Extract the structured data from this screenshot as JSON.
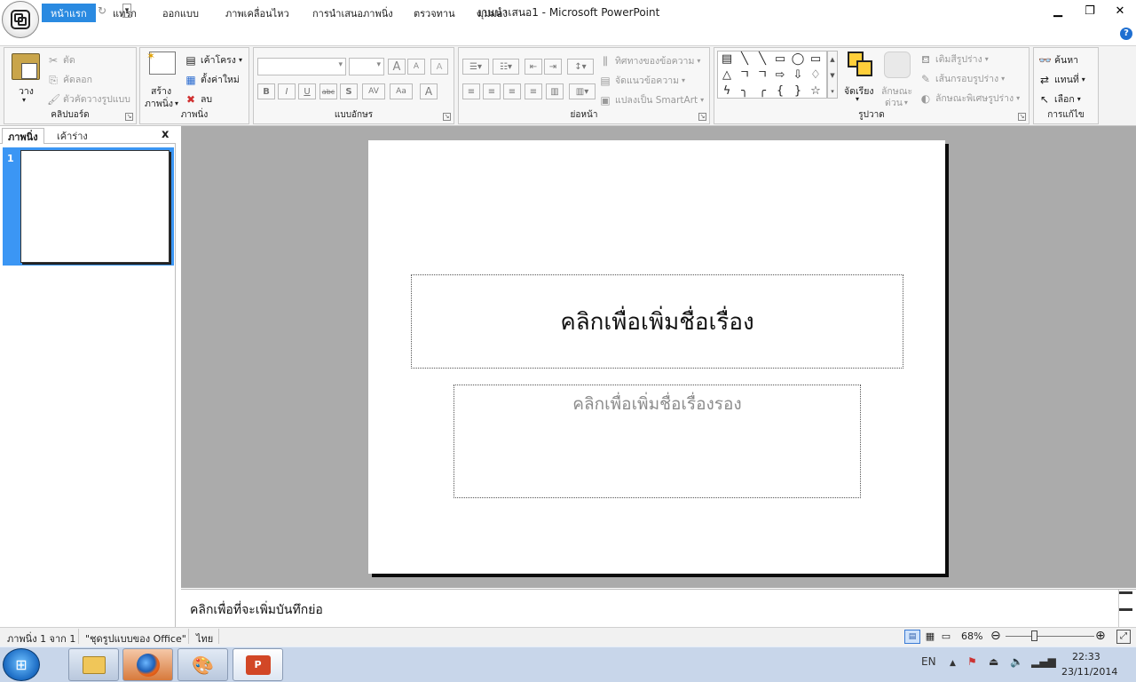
{
  "window": {
    "title": "งานนำเสนอ1 - Microsoft PowerPoint",
    "minimize": "▁",
    "restore": "❐",
    "close": "✕"
  },
  "quick_access": {
    "save": "💾",
    "undo": "↶",
    "redo": "↻",
    "more": "▾"
  },
  "tabs": [
    "หน้าแรก",
    "แทรก",
    "ออกแบบ",
    "ภาพเคลื่อนไหว",
    "การนำเสนอภาพนิ่ง",
    "ตรวจทาน",
    "มุมมอง"
  ],
  "help": "?",
  "ribbon": {
    "clipboard": {
      "label": "คลิปบอร์ด",
      "paste": "วาง",
      "cut": "ตัด",
      "copy": "คัดลอก",
      "format_painter": "ตัวคัดวางรูปแบบ"
    },
    "slides": {
      "label": "ภาพนิ่ง",
      "new_slide_1": "สร้าง",
      "new_slide_2": "ภาพนิ่ง",
      "layout": "เค้าโครง",
      "reset": "ตั้งค่าใหม่",
      "delete": "ลบ"
    },
    "font": {
      "label": "แบบอักษร",
      "bold": "B",
      "italic": "I",
      "underline": "U",
      "strike": "abc",
      "shadow": "S",
      "spacing": "AV",
      "case": "Aa",
      "color": "A",
      "grow": "A",
      "shrink": "A",
      "clear": "A"
    },
    "paragraph": {
      "label": "ย่อหน้า",
      "text_direction": "ทิศทางของข้อความ",
      "align_text": "จัดแนวข้อความ",
      "smartart": "แปลงเป็น SmartArt"
    },
    "drawing": {
      "label": "รูปวาด",
      "arrange": "จัดเรียง",
      "quick_styles_1": "ลักษณะ",
      "quick_styles_2": "ด่วน",
      "fill": "เติมสีรูปร่าง",
      "outline": "เส้นกรอบรูปร่าง",
      "effects": "ลักษณะพิเศษรูปร่าง",
      "shapes": [
        "▤",
        "╲",
        "╲",
        "▭",
        "◯",
        "▭",
        "△",
        "ㄱ",
        "ㄱ",
        "⇨",
        "⇩",
        "♢",
        "ϟ",
        "╮",
        "╭",
        "{",
        "}",
        "☆"
      ]
    },
    "editing": {
      "label": "การแก้ไข",
      "find": "ค้นหา",
      "replace": "แทนที่",
      "select": "เลือก"
    }
  },
  "left_pane": {
    "tab_slides": "ภาพนิ่ง",
    "tab_outline": "เค้าร่าง",
    "close": "x",
    "slide_number": "1"
  },
  "slide": {
    "title_placeholder": "คลิกเพื่อเพิ่มชื่อเรื่อง",
    "subtitle_placeholder": "คลิกเพื่อเพิ่มชื่อเรื่องรอง"
  },
  "notes": {
    "placeholder": "คลิกเพื่อที่จะเพิ่มบันทึกย่อ"
  },
  "status": {
    "slide_count": "ภาพนิ่ง 1 จาก 1",
    "theme": "\"ชุดรูปแบบของ Office\"",
    "language": "ไทย",
    "zoom": "68%",
    "zoom_out": "⊖",
    "zoom_in": "⊕"
  },
  "taskbar": {
    "lang": "EN",
    "time": "22:33",
    "date": "23/11/2014"
  }
}
